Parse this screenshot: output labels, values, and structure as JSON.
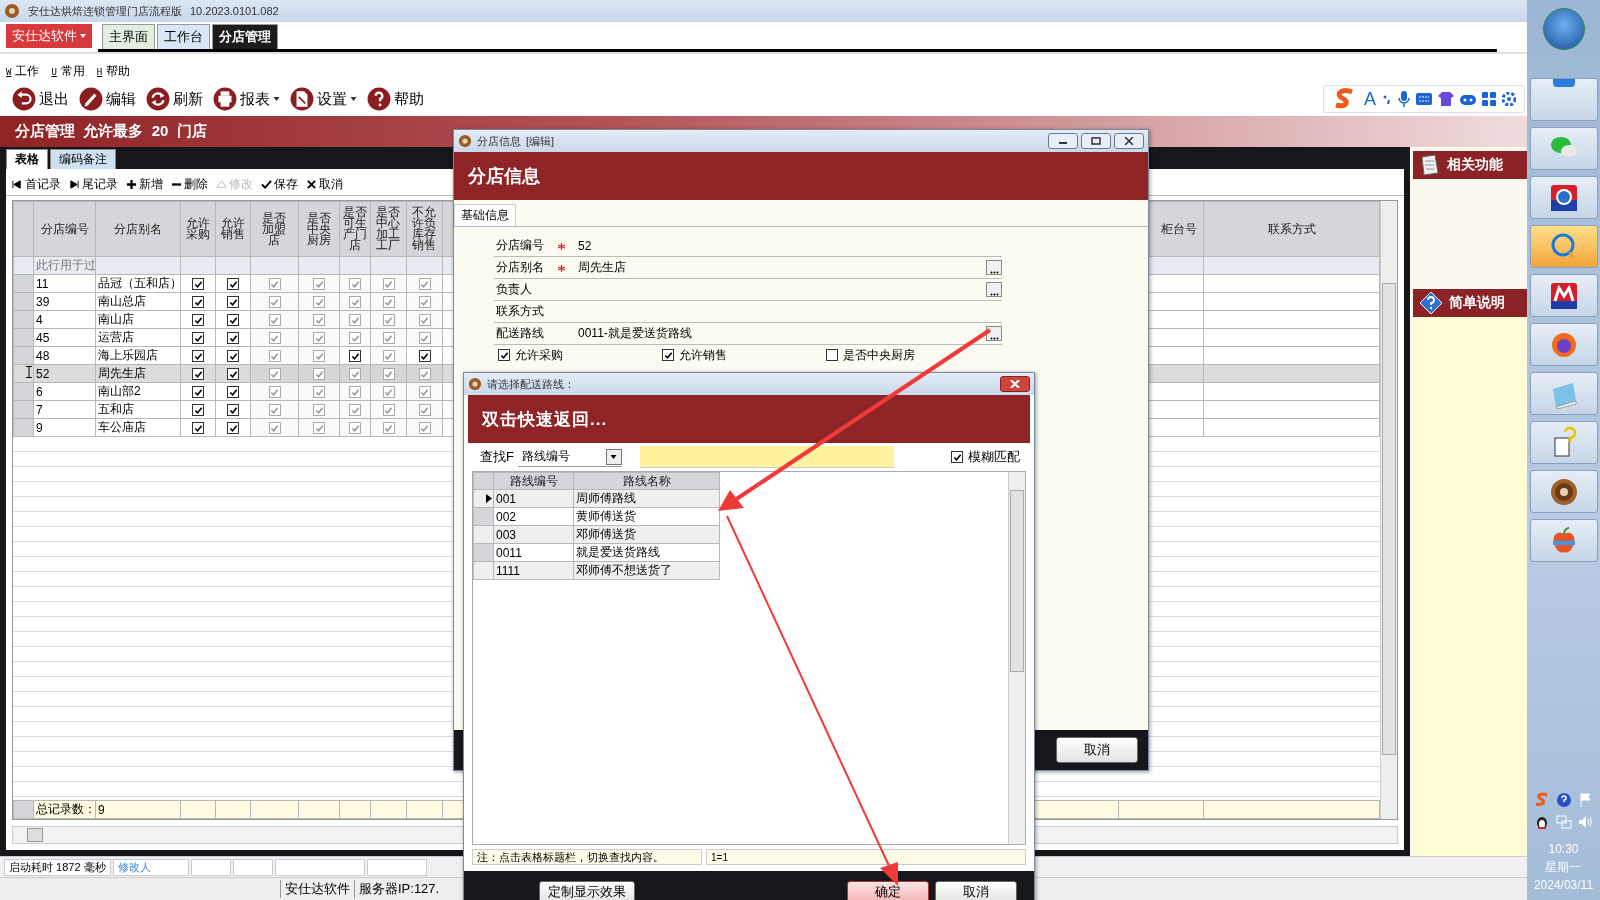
{
  "window": {
    "title": "安仕达烘焙连锁管理门店流程版",
    "version": "10.2023.0101.082"
  },
  "app_menu": "安仕达软件",
  "tabs": [
    {
      "label": "主界面",
      "selected": false
    },
    {
      "label": "工作台",
      "selected": false
    },
    {
      "label": "分店管理",
      "selected": true
    }
  ],
  "menu": [
    {
      "key": "W",
      "label": "工作"
    },
    {
      "key": "U",
      "label": "常用"
    },
    {
      "key": "H",
      "label": "帮助"
    }
  ],
  "toolbar": [
    {
      "label": "退出",
      "dropdown": false
    },
    {
      "label": "编辑",
      "dropdown": false
    },
    {
      "label": "刷新",
      "dropdown": false
    },
    {
      "label": "报表",
      "dropdown": true
    },
    {
      "label": "设置",
      "dropdown": true
    },
    {
      "label": "帮助",
      "dropdown": false
    }
  ],
  "ime_toolbar": {
    "mode": "A"
  },
  "banner": "分店管理  允许最多  20  门店",
  "sub_tabs": [
    {
      "label": "表格",
      "selected": true
    },
    {
      "label": "编码备注",
      "selected": false
    }
  ],
  "grid_toolbar": [
    {
      "label": "首记录",
      "disabled": false
    },
    {
      "label": "尾记录",
      "disabled": false
    },
    {
      "label": "新增",
      "disabled": false
    },
    {
      "label": "删除",
      "disabled": false
    },
    {
      "label": "修改",
      "disabled": true
    },
    {
      "label": "保存",
      "disabled": false
    },
    {
      "label": "取消",
      "disabled": false
    }
  ],
  "table": {
    "columns": [
      "分店编号",
      "分店别名",
      "允许采购",
      "允许销售",
      "是否加盟店",
      "是否中央厨房",
      "是否可生产门店",
      "是否中心加工工厂",
      "不允许负库存销售"
    ],
    "right_columns": [
      "柜台号",
      "联系方式"
    ],
    "filter_row": "此行用于过",
    "rows": [
      {
        "id": "11",
        "name": "品冠（五和店）",
        "selected": false,
        "checks": [
          true,
          true,
          true,
          true,
          true,
          true,
          true
        ],
        "disabled": [
          false,
          false,
          true,
          true,
          true,
          true,
          true
        ]
      },
      {
        "id": "39",
        "name": "南山总店",
        "selected": false,
        "checks": [
          true,
          true,
          true,
          true,
          true,
          true,
          true
        ],
        "disabled": [
          false,
          false,
          true,
          true,
          true,
          true,
          true
        ]
      },
      {
        "id": "4",
        "name": "南山店",
        "selected": false,
        "checks": [
          true,
          true,
          true,
          true,
          true,
          true,
          true
        ],
        "disabled": [
          false,
          false,
          true,
          true,
          true,
          true,
          true
        ]
      },
      {
        "id": "45",
        "name": "运营店",
        "selected": false,
        "checks": [
          true,
          true,
          true,
          true,
          true,
          true,
          true
        ],
        "disabled": [
          false,
          false,
          true,
          true,
          true,
          true,
          true
        ]
      },
      {
        "id": "48",
        "name": "海上乐园店",
        "selected": false,
        "checks": [
          true,
          true,
          true,
          true,
          true,
          true,
          true
        ],
        "disabled": [
          false,
          false,
          true,
          true,
          false,
          true,
          false
        ]
      },
      {
        "id": "52",
        "name": "周先生店",
        "selected": true,
        "checks": [
          true,
          true,
          true,
          true,
          true,
          true,
          true
        ],
        "disabled": [
          false,
          false,
          true,
          true,
          true,
          true,
          true
        ]
      },
      {
        "id": "6",
        "name": "南山部2",
        "selected": false,
        "checks": [
          true,
          true,
          true,
          true,
          true,
          true,
          true
        ],
        "disabled": [
          false,
          false,
          true,
          true,
          true,
          true,
          true
        ]
      },
      {
        "id": "7",
        "name": "五和店",
        "selected": false,
        "checks": [
          true,
          true,
          true,
          true,
          true,
          true,
          true
        ],
        "disabled": [
          false,
          false,
          true,
          true,
          true,
          true,
          true
        ]
      },
      {
        "id": "9",
        "name": "车公庙店",
        "selected": false,
        "checks": [
          true,
          true,
          true,
          true,
          true,
          true,
          true
        ],
        "disabled": [
          false,
          false,
          true,
          true,
          true,
          true,
          true
        ]
      }
    ],
    "footer_label": "总记录数：",
    "footer_count": "9"
  },
  "status_bar": {
    "startup": "启动耗时 1872 毫秒",
    "modifier": "修改人",
    "company": "安仕达软件",
    "server": "服务器IP:127."
  },
  "side_panels": [
    "相关功能",
    "简单说明"
  ],
  "taskbar": {
    "items": [
      {
        "selected": false
      },
      {
        "selected": false
      },
      {
        "selected": false
      },
      {
        "selected": true
      },
      {
        "selected": false
      },
      {
        "selected": false
      },
      {
        "selected": false
      },
      {
        "selected": false
      },
      {
        "selected": false
      },
      {
        "selected": false
      }
    ],
    "time": "10:30",
    "weekday": "星期一",
    "date": "2024/03/11"
  },
  "store_dialog": {
    "title": "分店信息",
    "mode": "[编辑]",
    "header": "分店信息",
    "tab": "基础信息",
    "fields": [
      {
        "label": "分店编号",
        "required": true,
        "value": "52",
        "browse": false
      },
      {
        "label": "分店别名",
        "required": true,
        "value": "周先生店",
        "browse": true
      },
      {
        "label": "负责人",
        "required": false,
        "browse": true
      },
      {
        "label": "联系方式",
        "required": false,
        "browse": false
      },
      {
        "label": "配送路线",
        "required": false,
        "value": "0011-就是爱送货路线",
        "browse": true
      }
    ],
    "checks": [
      {
        "label": "允许采购",
        "checked": true
      },
      {
        "label": "允许销售",
        "checked": true
      },
      {
        "label": "是否中央厨房",
        "checked": false
      }
    ],
    "cancel": "取消"
  },
  "route_dialog": {
    "title": "请选择配送路线：",
    "header": "双击快速返回...",
    "search_label": "查找F",
    "search_field": "路线编号",
    "fuzzy": {
      "label": "模糊匹配",
      "checked": true
    },
    "columns": [
      "路线编号",
      "路线名称"
    ],
    "rows": [
      {
        "code": "001",
        "name": "周师傅路线",
        "selected": true
      },
      {
        "code": "002",
        "name": "黄师傅送货",
        "selected": false
      },
      {
        "code": "003",
        "name": "邓师傅送货",
        "selected": false
      },
      {
        "code": "0011",
        "name": "就是爱送货路线",
        "selected": false
      },
      {
        "code": "1111",
        "name": "邓师傅不想送货了",
        "selected": false
      }
    ],
    "note": "注：点击表格标题栏，切换查找内容。",
    "condition": "1=1",
    "buttons": [
      {
        "label": "定制显示效果",
        "default": false
      },
      {
        "label": "确定",
        "default": true
      },
      {
        "label": "取消",
        "default": false
      }
    ]
  }
}
